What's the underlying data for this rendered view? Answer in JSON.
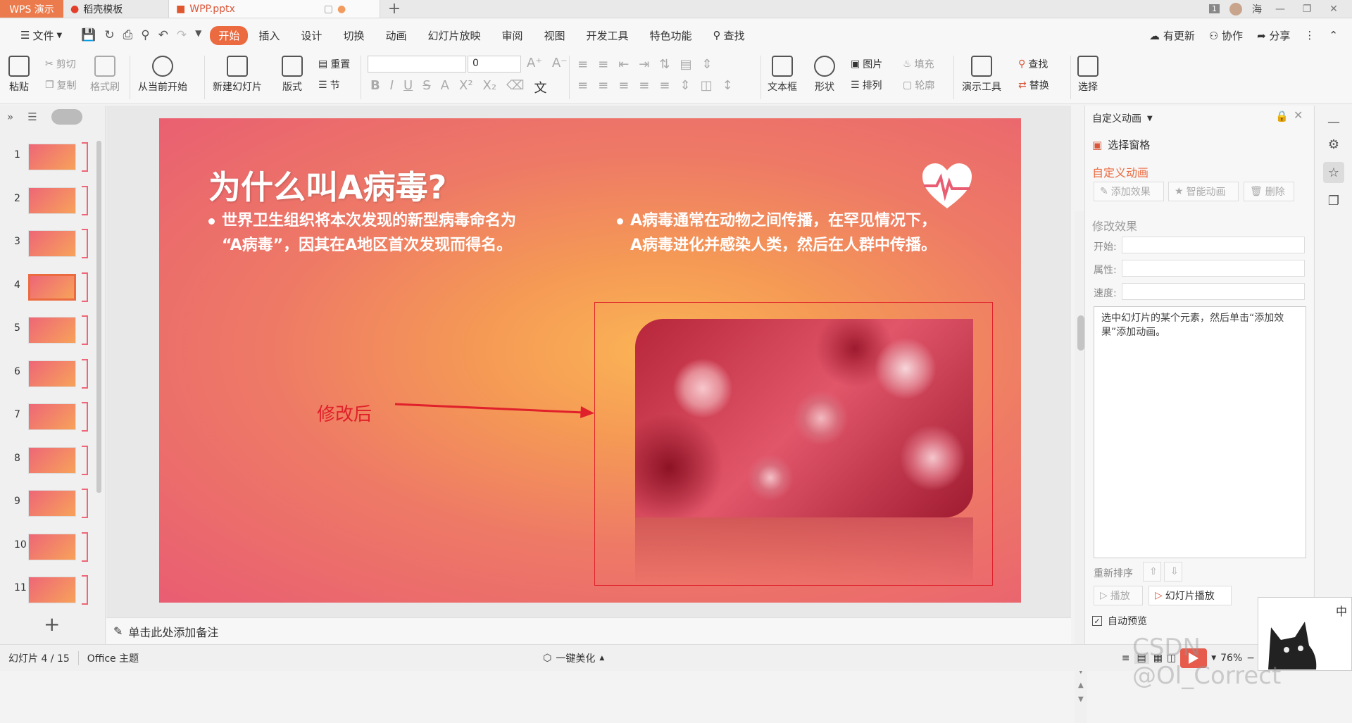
{
  "titlebar": {
    "app_tab": "WPS 演示",
    "tabs": [
      {
        "label": "稻壳模板"
      },
      {
        "label": "WPP.pptx"
      }
    ],
    "badge": "1",
    "user": "海"
  },
  "menubar": {
    "file": "文件",
    "items": [
      "开始",
      "插入",
      "设计",
      "切换",
      "动画",
      "幻灯片放映",
      "审阅",
      "视图",
      "开发工具",
      "特色功能"
    ],
    "search": "查找",
    "right": [
      "有更新",
      "协作",
      "分享"
    ]
  },
  "ribbon": {
    "paste": "粘贴",
    "cut": "剪切",
    "copy": "复制",
    "format_brush": "格式刷",
    "start_from_current": "从当前开始",
    "new_slide": "新建幻灯片",
    "layout": "版式",
    "section": "节",
    "reset": "重置",
    "font_size": "0",
    "textbox": "文本框",
    "shape": "形状",
    "arrange": "排列",
    "picture": "图片",
    "fill": "填充",
    "outline": "轮廓",
    "presentation_tools": "演示工具",
    "find": "查找",
    "replace": "替换",
    "select": "选择"
  },
  "thumbnails": {
    "numbers": [
      "1",
      "2",
      "3",
      "4",
      "5",
      "6",
      "7",
      "8",
      "9",
      "10",
      "11"
    ],
    "selected": "4"
  },
  "slide": {
    "title": "为什么叫A病毒?",
    "bullet_left": [
      "世界卫生组织将本次发现的新型病毒命名为",
      "“A病毒”，因其在A地区首次发现而得名。"
    ],
    "bullet_right": [
      "A病毒通常在动物之间传播，在罕见情况下，",
      "A病毒进化并感染人类，然后在人群中传播。"
    ],
    "annotation": "修改后"
  },
  "notes": {
    "placeholder": "单击此处添加备注"
  },
  "rightpane": {
    "header": "自定义动画",
    "select_pane": "选择窗格",
    "section_title": "自定义动画",
    "add_effect": "添加效果",
    "smart_anim": "智能动画",
    "delete": "删除",
    "modify_title": "修改效果",
    "start_label": "开始:",
    "prop_label": "属性:",
    "speed_label": "速度:",
    "hint": "选中幻灯片的某个元素，然后单击“添加效果”添加动画。",
    "reorder": "重新排序",
    "play": "播放",
    "slideshow": "幻灯片播放",
    "autopreview": "自动预览"
  },
  "status": {
    "slide_pos": "幻灯片 4 / 15",
    "theme": "Office 主题",
    "beautify": "一键美化",
    "zoom": "76%",
    "watermark": "CSDN @Ol_Correct",
    "ime": "中"
  },
  "colors": {
    "accent": "#eb6a3f",
    "selection": "#e0202a"
  }
}
